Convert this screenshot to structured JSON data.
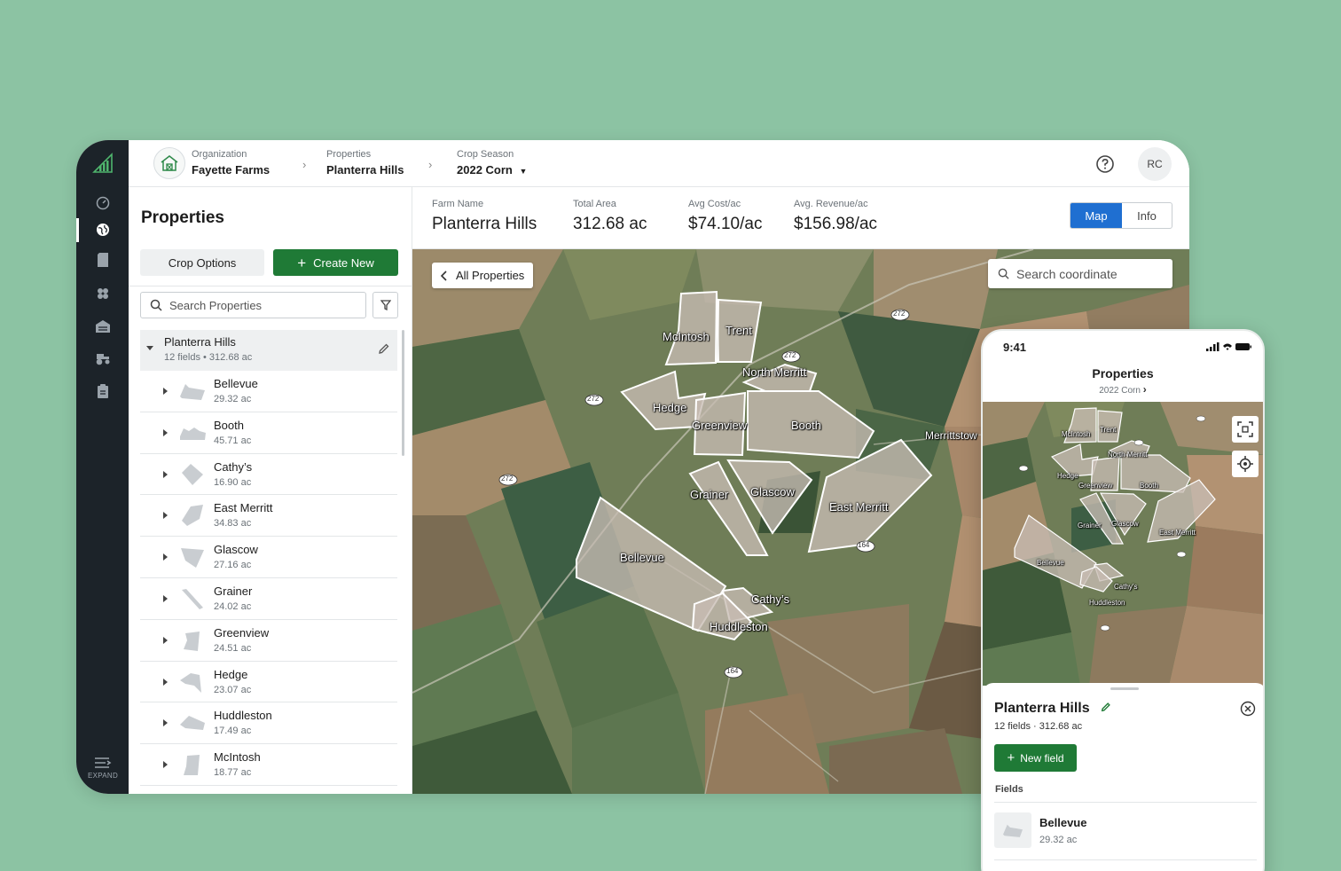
{
  "breadcrumb": {
    "organization": {
      "label": "Organization",
      "value": "Fayette Farms"
    },
    "properties": {
      "label": "Properties",
      "value": "Planterra Hills"
    },
    "season": {
      "label": "Crop Season",
      "value": "2022 Corn"
    }
  },
  "user": {
    "initials": "RC"
  },
  "rail": {
    "expand_label": "EXPAND"
  },
  "left_panel": {
    "title": "Properties",
    "crop_options": "Crop Options",
    "create_new": "Create New",
    "search_placeholder": "Search Properties",
    "property": {
      "name": "Planterra Hills",
      "subtitle": "12 fields  •  312.68 ac"
    },
    "fields": [
      {
        "name": "Bellevue",
        "area": "29.32 ac"
      },
      {
        "name": "Booth",
        "area": "45.71 ac"
      },
      {
        "name": "Cathy’s",
        "area": "16.90 ac"
      },
      {
        "name": "East Merritt",
        "area": "34.83 ac"
      },
      {
        "name": "Glascow",
        "area": "27.16 ac"
      },
      {
        "name": "Grainer",
        "area": "24.02 ac"
      },
      {
        "name": "Greenview",
        "area": "24.51 ac"
      },
      {
        "name": "Hedge",
        "area": "23.07 ac"
      },
      {
        "name": "Huddleston",
        "area": "17.49 ac"
      },
      {
        "name": "McIntosh",
        "area": "18.77 ac"
      }
    ]
  },
  "stats": {
    "farm_name": {
      "label": "Farm Name",
      "value": "Planterra Hills"
    },
    "total_area": {
      "label": "Total Area",
      "value": "312.68 ac"
    },
    "avg_cost": {
      "label": "Avg Cost/ac",
      "value": "$74.10/ac"
    },
    "avg_revenue": {
      "label": "Avg. Revenue/ac",
      "value": "$156.98/ac"
    }
  },
  "view_toggle": {
    "map": "Map",
    "info": "Info",
    "selected": "Map"
  },
  "map": {
    "all_properties": "All Properties",
    "search_placeholder": "Search coordinate",
    "field_labels": {
      "mcintosh": "McIntosh",
      "trent": "Trent",
      "north_merritt": "North Merritt",
      "hedge": "Hedge",
      "greenview": "Greenview",
      "booth": "Booth",
      "grainer": "Grainer",
      "glascow": "Glascow",
      "east_merritt": "East Merritt",
      "bellevue": "Bellevue",
      "cathys": "Cathy’s",
      "huddleston": "Huddleston"
    },
    "place_labels": {
      "merrittstown": "Merrittstow"
    },
    "road_shields": [
      "272",
      "272",
      "272",
      "164",
      "164",
      "272",
      "164"
    ]
  },
  "phone": {
    "time": "9:41",
    "title": "Properties",
    "subtitle": "2022 Corn",
    "sheet": {
      "name": "Planterra Hills",
      "subtitle": "12 fields · 312.68 ac",
      "new_field": "New field",
      "fields_label": "Fields",
      "first_field": {
        "name": "Bellevue",
        "area": "29.32 ac"
      }
    }
  },
  "colors": {
    "primary_green": "#1f7a36",
    "toggle_blue": "#1f6fd1",
    "rail_dark": "#1c2329",
    "background": "#8cc3a3"
  }
}
